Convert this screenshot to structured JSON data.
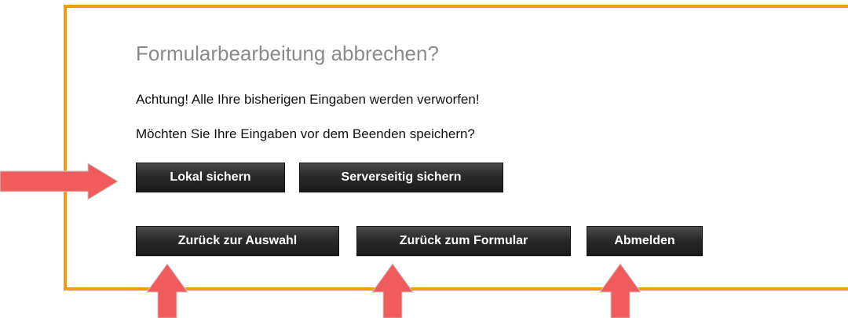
{
  "dialog": {
    "title": "Formularbearbeitung abbrechen?",
    "warning": "Achtung! Alle Ihre bisherigen Eingaben werden verworfen!",
    "question": "Möchten Sie Ihre Eingaben vor dem Beenden speichern?",
    "buttons": {
      "save_local": "Lokal sichern",
      "save_server": "Serverseitig sichern",
      "back_to_selection": "Zurück zur Auswahl",
      "back_to_form": "Zurück zum Formular",
      "logout": "Abmelden"
    }
  },
  "colors": {
    "border": "#f39c12",
    "arrow": "#f25b5b",
    "button": "#2a2a2a"
  }
}
